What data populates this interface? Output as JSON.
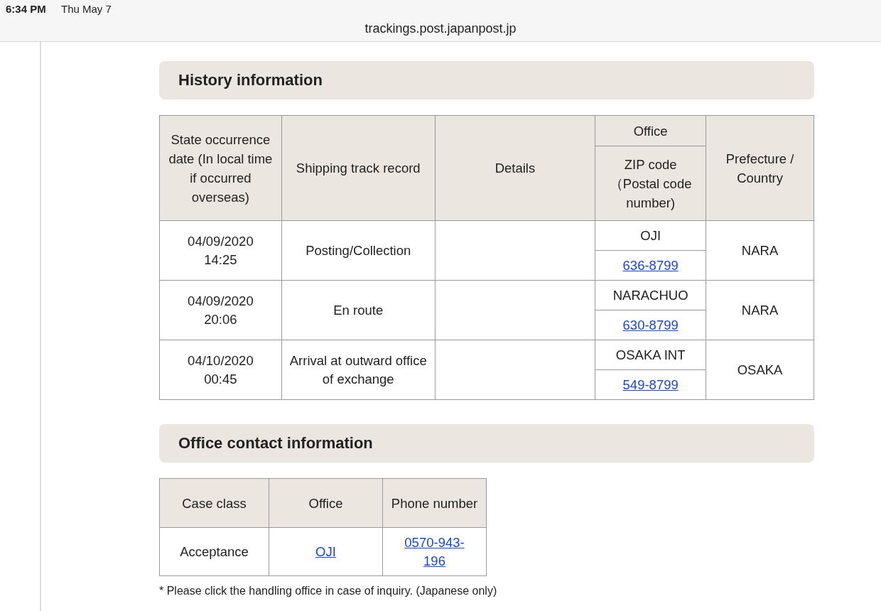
{
  "status_bar": {
    "time": "6:34 PM",
    "date": "Thu May 7",
    "url": "trackings.post.japanpost.jp"
  },
  "history": {
    "title": "History information",
    "columns": {
      "date": "State occurrence date (In local time if occurred overseas)",
      "record": "Shipping track record",
      "details": "Details",
      "office": "Office",
      "zip": "ZIP code（Postal code number)",
      "prefecture": "Prefecture / Country"
    },
    "rows": [
      {
        "date": "04/09/2020",
        "time": "14:25",
        "record": "Posting/Collection",
        "office": "OJI",
        "zip": "636-8799",
        "prefecture": "NARA"
      },
      {
        "date": "04/09/2020",
        "time": "20:06",
        "record": "En route",
        "office": "NARACHUO",
        "zip": "630-8799",
        "prefecture": "NARA"
      },
      {
        "date": "04/10/2020",
        "time": "00:45",
        "record": "Arrival at outward office of exchange",
        "office": "OSAKA INT",
        "zip": "549-8799",
        "prefecture": "OSAKA"
      }
    ]
  },
  "contact": {
    "title": "Office contact information",
    "columns": [
      "Case class",
      "Office",
      "Phone number"
    ],
    "rows": [
      {
        "case_class": "Acceptance",
        "office": "OJI",
        "phone": "0570-943-196"
      }
    ],
    "note": "* Please click the handling office in case of inquiry. (Japanese only)"
  }
}
